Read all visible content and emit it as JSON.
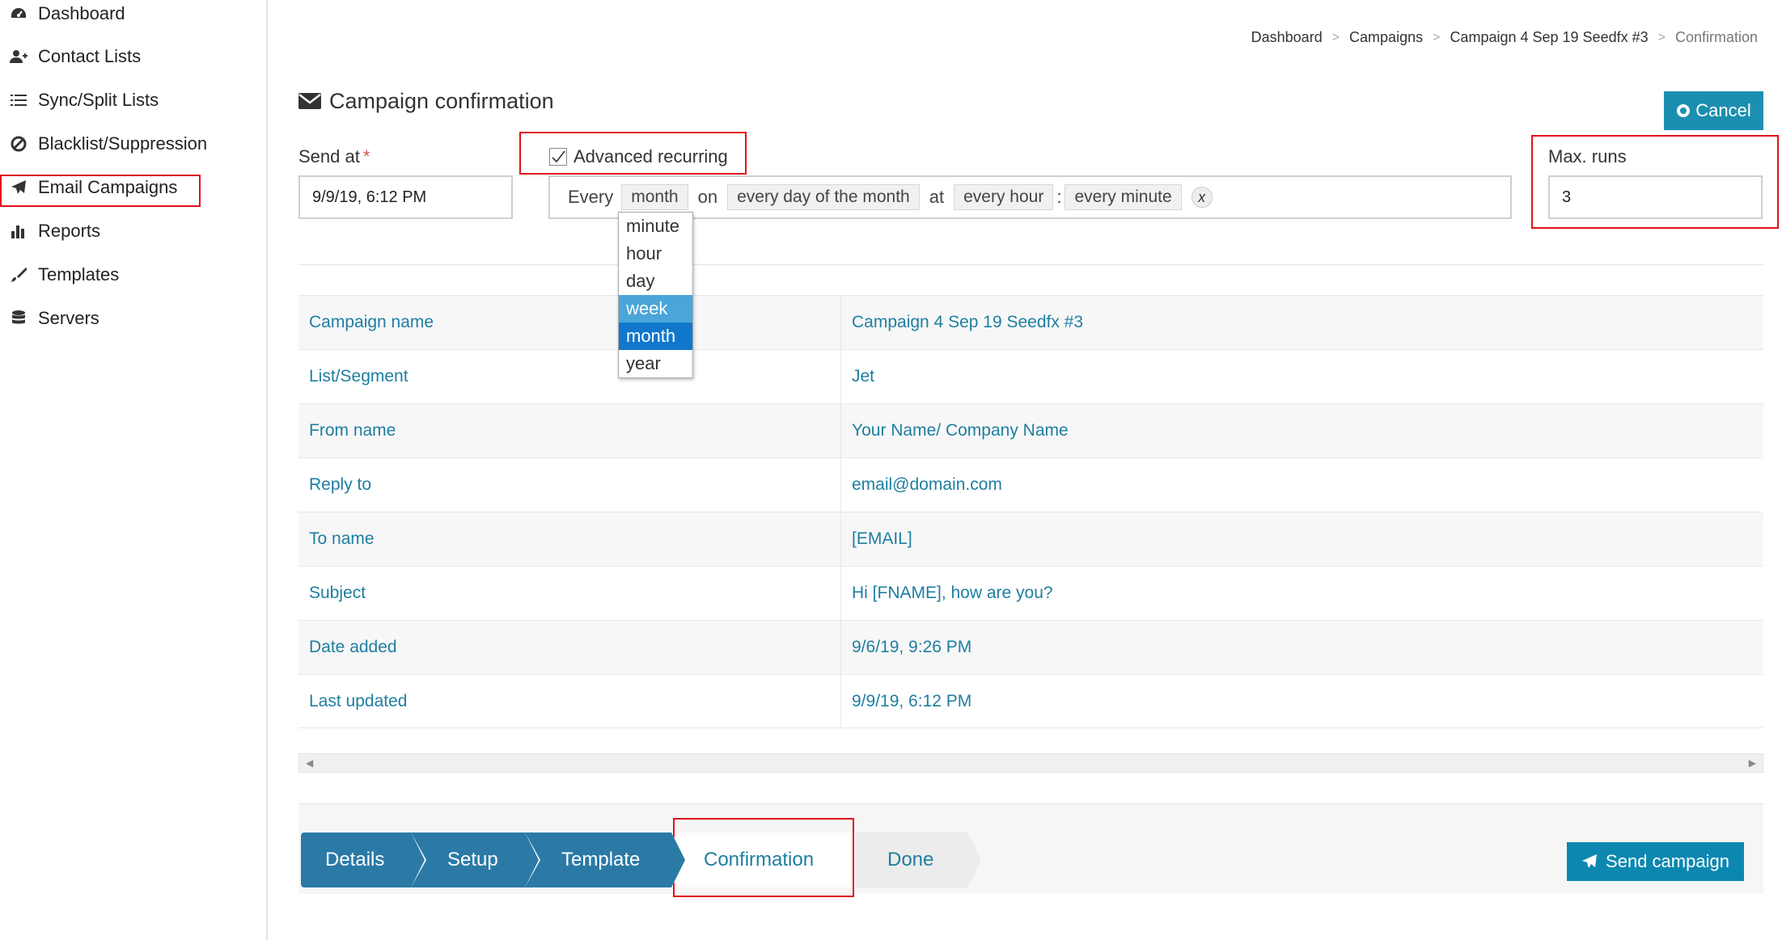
{
  "sidebar": {
    "items": [
      {
        "label": "Dashboard",
        "icon": "dashboard-icon"
      },
      {
        "label": "Contact Lists",
        "icon": "add-user-icon"
      },
      {
        "label": "Sync/Split Lists",
        "icon": "list-icon"
      },
      {
        "label": "Blacklist/Suppression",
        "icon": "ban-icon"
      },
      {
        "label": "Email Campaigns",
        "icon": "paper-plane-icon"
      },
      {
        "label": "Reports",
        "icon": "bar-chart-icon"
      },
      {
        "label": "Templates",
        "icon": "brush-icon"
      },
      {
        "label": "Servers",
        "icon": "database-icon"
      }
    ]
  },
  "breadcrumb": [
    "Dashboard",
    "Campaigns",
    "Campaign 4 Sep 19 Seedfx #3",
    "Confirmation"
  ],
  "title": "Campaign confirmation",
  "cancel_label": "Cancel",
  "form": {
    "send_at_label": "Send at",
    "send_at_required": "*",
    "send_at_value": "9/9/19, 6:12 PM",
    "advanced_recurring_label": "Advanced recurring",
    "advanced_recurring_checked": true,
    "max_runs_label": "Max. runs",
    "max_runs_value": "3"
  },
  "recurring": {
    "every_word": "Every",
    "period": "month",
    "on_word": "on",
    "day_of_month": "every day of the month",
    "at_word": "at",
    "hour": "every hour",
    "colon": ":",
    "minute": "every minute",
    "clear_label": "x",
    "dropdown_options": [
      "minute",
      "hour",
      "day",
      "week",
      "month",
      "year"
    ],
    "dropdown_hovered": "week",
    "dropdown_selected": "month"
  },
  "details": [
    {
      "key": "Campaign name",
      "value": "Campaign 4 Sep 19 Seedfx #3"
    },
    {
      "key": "List/Segment",
      "value": "Jet"
    },
    {
      "key": "From name",
      "value": "Your Name/ Company Name"
    },
    {
      "key": "Reply to",
      "value": "email@domain.com"
    },
    {
      "key": "To name",
      "value": "[EMAIL]"
    },
    {
      "key": "Subject",
      "value": "Hi [FNAME], how are you?"
    },
    {
      "key": "Date added",
      "value": "9/6/19, 9:26 PM"
    },
    {
      "key": "Last updated",
      "value": "9/9/19, 6:12 PM"
    }
  ],
  "wizard": {
    "steps": [
      "Details",
      "Setup",
      "Template",
      "Confirmation",
      "Done"
    ],
    "active": "Confirmation"
  },
  "send_label": "Send campaign",
  "colors": {
    "primary": "#1c8fb0",
    "step_done": "#2b7aa6",
    "link_text": "#1e7ea1",
    "highlight_box": "#e0121b"
  }
}
